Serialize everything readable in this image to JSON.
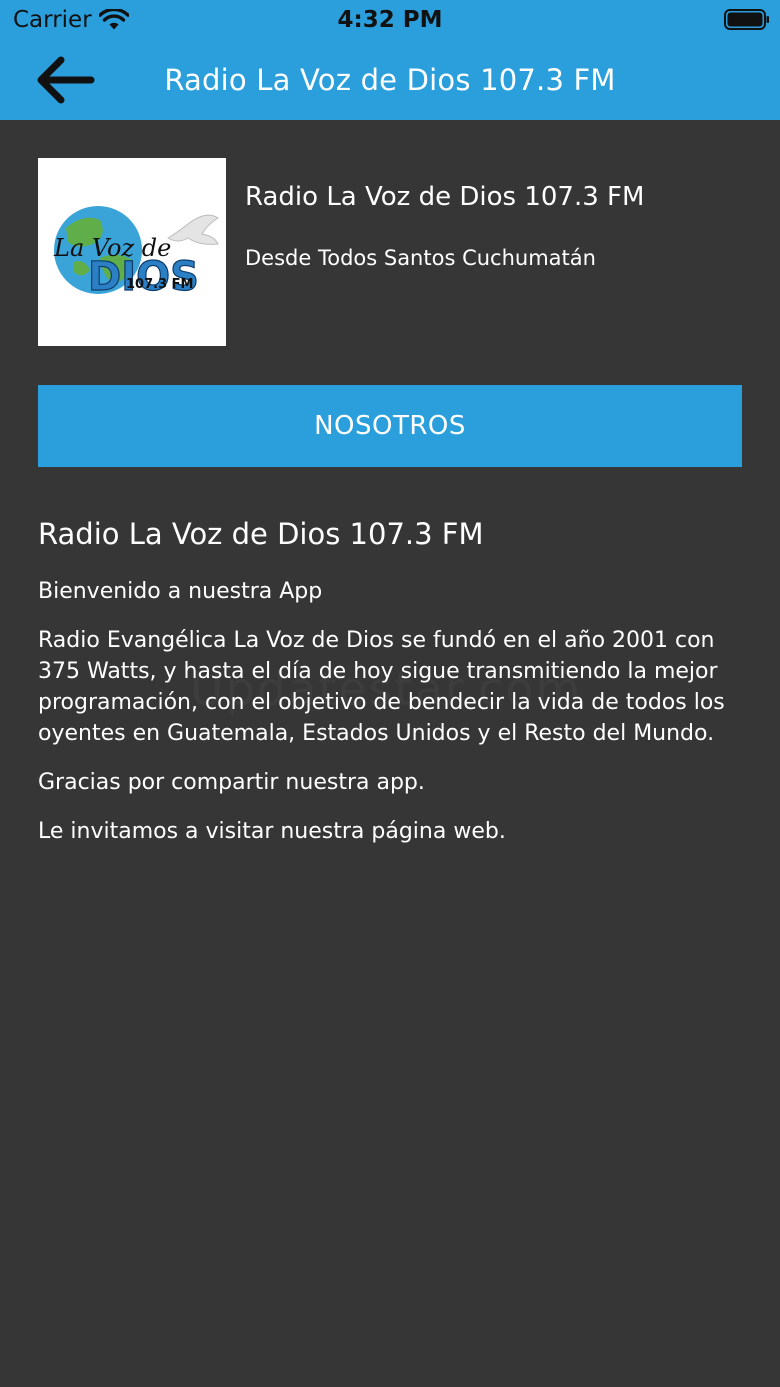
{
  "status_bar": {
    "carrier": "Carrier",
    "time": "4:32 PM",
    "wifi_icon": "wifi-icon",
    "battery_icon": "battery-full-icon"
  },
  "nav": {
    "back_icon": "arrow-left-icon",
    "title": "Radio La Voz de Dios 107.3 FM"
  },
  "station": {
    "logo_icon": "station-logo",
    "logo_text_line1": "La Voz de",
    "logo_text_line2": "DIOS",
    "logo_text_line3": "107.3 FM",
    "name": "Radio La Voz de Dios 107.3 FM",
    "location": "Desde Todos Santos Cuchumatán"
  },
  "tab": {
    "label": "NOSOTROS"
  },
  "content": {
    "title": "Radio La Voz de Dios 107.3 FM",
    "paragraphs": [
      "Bienvenido a nuestra App",
      "Radio Evangélica La Voz de Dios se fundó en el año 2001 con 375 Watts, y hasta el día de hoy sigue transmitiendo la mejor programación, con el objetivo de bendecir la vida de todos los oyentes en Guatemala, Estados Unidos y el Resto del Mundo.",
      "Gracias por compartir nuestra app.",
      "Le invitamos a visitar nuestra página web."
    ]
  },
  "watermark": "Updatestar.com",
  "colors": {
    "accent": "#2b9fdc",
    "background": "#363636",
    "text": "#ffffff"
  }
}
